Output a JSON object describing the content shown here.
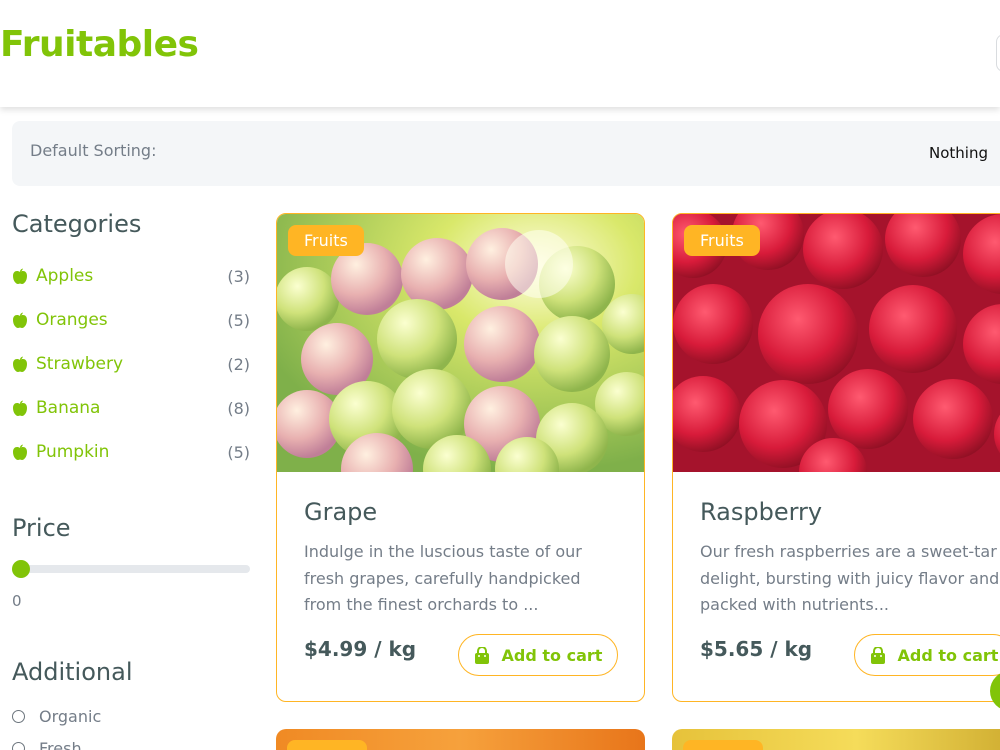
{
  "brand": "Fruitables",
  "sort": {
    "label": "Default Sorting:",
    "value": "Nothing"
  },
  "categories": {
    "title": "Categories",
    "items": [
      {
        "label": "Apples",
        "count": "(3)"
      },
      {
        "label": "Oranges",
        "count": "(5)"
      },
      {
        "label": "Strawbery",
        "count": "(2)"
      },
      {
        "label": "Banana",
        "count": "(8)"
      },
      {
        "label": "Pumpkin",
        "count": "(5)"
      }
    ]
  },
  "price": {
    "title": "Price",
    "value": "0",
    "fraction": 0
  },
  "additional": {
    "title": "Additional",
    "options": [
      "Organic",
      "Fresh"
    ]
  },
  "products": [
    {
      "badge": "Fruits",
      "name": "Grape",
      "desc_lines": [
        "Indulge in the luscious taste of our",
        "fresh grapes, carefully handpicked",
        "from the finest orchards to ..."
      ],
      "price": "$4.99 / kg",
      "cart": "Add to cart"
    },
    {
      "badge": "Fruits",
      "name": "Raspberry",
      "desc_lines": [
        "Our fresh raspberries are a sweet-tar",
        "delight, bursting with juicy flavor and",
        "packed with nutrients..."
      ],
      "price": "$5.65 / kg",
      "cart": "Add to cart"
    }
  ],
  "colors": {
    "brand": "#81c408",
    "accent": "#ffb524",
    "text": "#45595b",
    "muted": "#747d88"
  },
  "icons": {
    "category": "apple-icon",
    "cart": "shopping-bag-icon"
  }
}
